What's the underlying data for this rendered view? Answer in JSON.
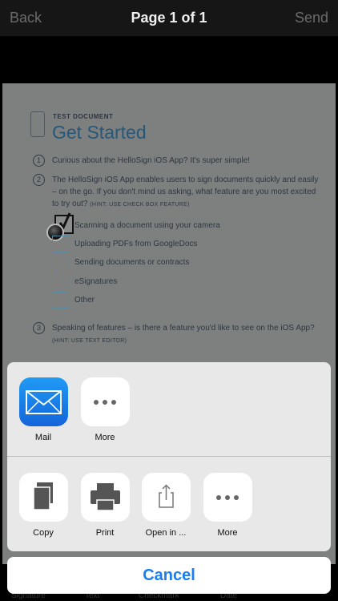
{
  "navbar": {
    "back_label": "Back",
    "title": "Page 1 of 1",
    "send_label": "Send"
  },
  "document": {
    "kicker": "TEST DOCUMENT",
    "title": "Get Started",
    "questions": [
      {
        "number": "1",
        "text": "Curious about the HelloSign iOS App? It's super simple!"
      },
      {
        "number": "2",
        "text": "The HelloSign iOS App enables users to sign documents quickly and easily – on the go. If you don't mind us asking, what feature are you most excited to try out?",
        "hint": "(HINT: USE CHECK BOX FEATURE)"
      },
      {
        "number": "3",
        "text": "Speaking of features – is there a feature you'd like to see on the iOS App?",
        "hint": "(HINT: USE TEXT EDITOR)"
      }
    ],
    "options": [
      "Scanning a document using your camera",
      "Uploading PDFs from GoogleDocs",
      "Sending documents or contracts",
      "eSignatures",
      "Other"
    ]
  },
  "share_sheet": {
    "row1": [
      {
        "label": "Mail",
        "icon": "mail-icon"
      },
      {
        "label": "More",
        "icon": "more-icon"
      }
    ],
    "row2": [
      {
        "label": "Copy",
        "icon": "copy-icon"
      },
      {
        "label": "Print",
        "icon": "print-icon"
      },
      {
        "label": "Open in ...",
        "icon": "open-in-icon"
      },
      {
        "label": "More",
        "icon": "more-icon"
      }
    ],
    "cancel_label": "Cancel"
  },
  "bottom_tabs": [
    "Signature",
    "Text",
    "Checkmark",
    "Date"
  ],
  "colors": {
    "accent": "#1a7df0",
    "mail_icon": "#1a86f0",
    "doc_title": "#26577a"
  }
}
